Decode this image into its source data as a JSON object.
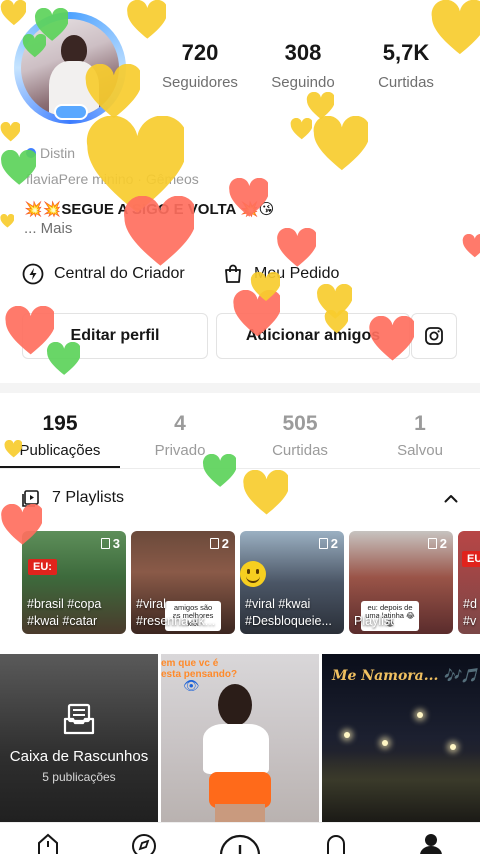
{
  "profile": {
    "stats": [
      {
        "value": "720",
        "label": "Seguidores"
      },
      {
        "value": "308",
        "label": "Seguindo"
      },
      {
        "value": "5,7K",
        "label": "Curtidas"
      }
    ],
    "badge_text": "Distin",
    "info_text": "flaviaPere     minino · Gêmeos",
    "bio_text": "💥💥SEGUE A    SIGO E VOLTA 💥😘",
    "bio_more": "... Mais"
  },
  "links": {
    "creator_center": "Central do Criador",
    "my_orders": "Meu Pedido"
  },
  "buttons": {
    "edit_profile": "Editar perfil",
    "add_friends": "Adicionar amigos"
  },
  "tabs": [
    {
      "count": "195",
      "label": "Publicações"
    },
    {
      "count": "4",
      "label": "Privado"
    },
    {
      "count": "505",
      "label": "Curtidas"
    },
    {
      "count": "1",
      "label": "Salvou"
    }
  ],
  "playlists": {
    "header": "7 Playlists",
    "items": [
      {
        "count": "3",
        "tags_line1": "#brasil #copa",
        "tags_line2": "#kwai #catar",
        "badge": "EU:"
      },
      {
        "count": "2",
        "tags_line1": "#viral",
        "tags_line2": "#resenha #k...",
        "caption": "amigos são as melhores kkk"
      },
      {
        "count": "2",
        "tags_line1": "#viral #kwai",
        "tags_line2": "#Desbloqueie..."
      },
      {
        "count": "2",
        "tags_line1": "",
        "tags_line2": "Playlist",
        "caption": "eu: depois de uma latinha 😂😂"
      },
      {
        "count": "",
        "tags_line1": "#d",
        "tags_line2": "#v",
        "badge": "EU:"
      }
    ]
  },
  "grid": {
    "drafts_title": "Caixa de Rascunhos",
    "drafts_sub": "5 publicações",
    "cell2_caption": "em que vc é esta pensando?",
    "cell3_title": "Me Namora...",
    "cell3_notes": "🎶🎵"
  },
  "colors": {
    "heart_yellow": "#f7cc2e",
    "heart_red": "#ff6f5e",
    "heart_green": "#5cd35a",
    "accent_text": "#161616"
  }
}
